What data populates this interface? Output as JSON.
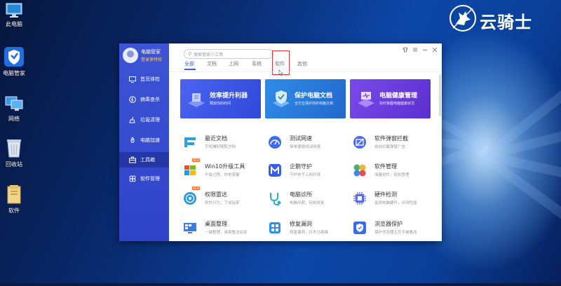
{
  "desktop": {
    "icons": [
      {
        "label": "此电脑",
        "icon": "computer-icon"
      },
      {
        "label": "电脑管家",
        "icon": "shield-app-icon"
      },
      {
        "label": "网络",
        "icon": "network-icon"
      },
      {
        "label": "回收站",
        "icon": "recycle-bin-icon"
      },
      {
        "label": "软件",
        "icon": "folder-icon"
      }
    ],
    "watermark": {
      "text": "云骑士",
      "icon": "knight-logo-icon"
    }
  },
  "app": {
    "profile": {
      "name": "电脑管家",
      "login": "登录享特权",
      "icon": "avatar-icon"
    },
    "sidebar": [
      {
        "label": "首页体检",
        "icon": "monitor-icon"
      },
      {
        "label": "病毒查杀",
        "icon": "lightning-icon"
      },
      {
        "label": "垃圾清理",
        "icon": "broom-icon"
      },
      {
        "label": "电脑加速",
        "icon": "rocket-icon"
      },
      {
        "label": "工具箱",
        "icon": "toolbox-icon",
        "active": true
      },
      {
        "label": "软件管理",
        "icon": "apps-icon"
      }
    ],
    "search": {
      "placeholder": "搜索管家小工具",
      "icon": "search-icon"
    },
    "window_controls": [
      "shirt-icon",
      "menu-icon",
      "minimize-icon",
      "close-icon"
    ],
    "tabs": [
      {
        "label": "全部",
        "active": true
      },
      {
        "label": "文档"
      },
      {
        "label": "上网"
      },
      {
        "label": "系统"
      },
      {
        "label": "软件",
        "highlighted": true
      },
      {
        "label": "其他"
      }
    ],
    "banners": [
      {
        "title": "效率提升利器",
        "subtitle": "释放你的时间",
        "color_from": "#4d64f2",
        "color_to": "#2f48d8"
      },
      {
        "title": "保护电脑文档",
        "subtitle": "全方位保护你的电脑文档",
        "color_from": "#2f8ce8",
        "color_to": "#2368cc"
      },
      {
        "title": "电脑健康管理",
        "subtitle": "实时掌握电脑健康状况",
        "color_from": "#7a4ae8",
        "color_to": "#5a2fd0"
      }
    ],
    "tools": [
      {
        "name": "最近文档",
        "desc": "手机赚好随取文档",
        "icon": "recent-docs-icon",
        "color": "#2aa3d8"
      },
      {
        "name": "测试网速",
        "desc": "简单便捷测试网速",
        "icon": "speed-test-icon",
        "color": "#3d6cf0"
      },
      {
        "name": "软件弹窗拦截",
        "desc": "自动拦截弹窗广告",
        "icon": "popup-block-icon",
        "color": "#4a6cf4"
      },
      {
        "name": "Win10升级工具",
        "desc": "升级过程，你电掌握",
        "icon": "windows-icon",
        "color": "#2a88e8",
        "badge": "NEW"
      },
      {
        "name": "企鹅守护",
        "desc": "守护孩子上网环境",
        "icon": "penguin-guard-icon",
        "color": "#3a5de8"
      },
      {
        "name": "软件管理",
        "desc": "海量软件，轻松管理",
        "icon": "software-mgmt-icon",
        "color": "#4ab06a"
      },
      {
        "name": "权限雷达",
        "desc": "软件行为，了如指掌",
        "icon": "radar-icon",
        "color": "#2a9ae0",
        "badge": "NEW"
      },
      {
        "name": "电脑诊所",
        "desc": "电脑问题，轻松修复",
        "icon": "stethoscope-icon",
        "color": "#2ab0c8"
      },
      {
        "name": "硬件检测",
        "desc": "监测电脑硬件，评测性能",
        "icon": "chip-icon",
        "color": "#5a6cf0"
      },
      {
        "name": "桌面整理",
        "desc": "一键整理，桌面整洁如初",
        "icon": "desktop-organize-icon",
        "color": "#3a7ce8"
      },
      {
        "name": "修复漏洞",
        "desc": "修复漏洞，拦木马病毒",
        "icon": "patch-icon",
        "color": "#2a90e8"
      },
      {
        "name": "浏览器保护",
        "desc": "保护浏览器主页不被篡改",
        "icon": "browser-shield-icon",
        "color": "#3a6ce8"
      }
    ]
  }
}
